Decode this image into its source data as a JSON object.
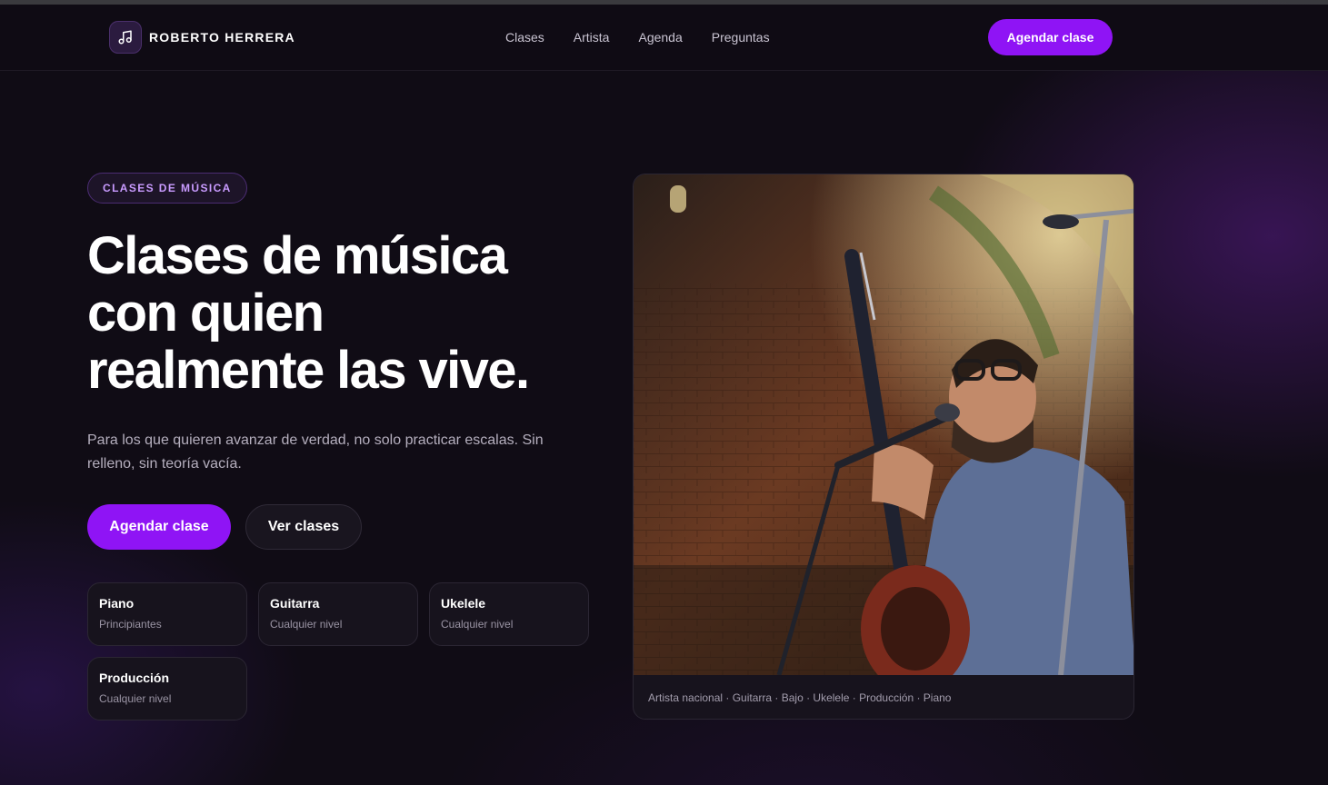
{
  "header": {
    "brand_name": "ROBERTO HERRERA",
    "nav": [
      "Clases",
      "Artista",
      "Agenda",
      "Preguntas"
    ],
    "cta": "Agendar clase"
  },
  "hero": {
    "badge": "CLASES DE MÚSICA",
    "title_lines": [
      "Clases de música",
      "con quien",
      "realmente las vive."
    ],
    "lead": "Para los que quieren avanzar de verdad, no solo practicar escalas. Sin relleno, sin teoría vacía.",
    "primary_button": "Agendar clase",
    "secondary_button": "Ver clases",
    "cards": [
      {
        "title": "Piano",
        "sub": "Principiantes"
      },
      {
        "title": "Guitarra",
        "sub": "Cualquier nivel"
      },
      {
        "title": "Ukelele",
        "sub": "Cualquier nivel"
      },
      {
        "title": "Producción",
        "sub": "Cualquier nivel"
      }
    ],
    "photo_caption": "Artista nacional · Guitarra · Bajo · Ukelele · Producción · Piano"
  },
  "icons": {
    "brand": "music-note-icon"
  },
  "colors": {
    "accent": "#8f14f5",
    "background": "#100c15",
    "badge_text": "#c99bff"
  }
}
